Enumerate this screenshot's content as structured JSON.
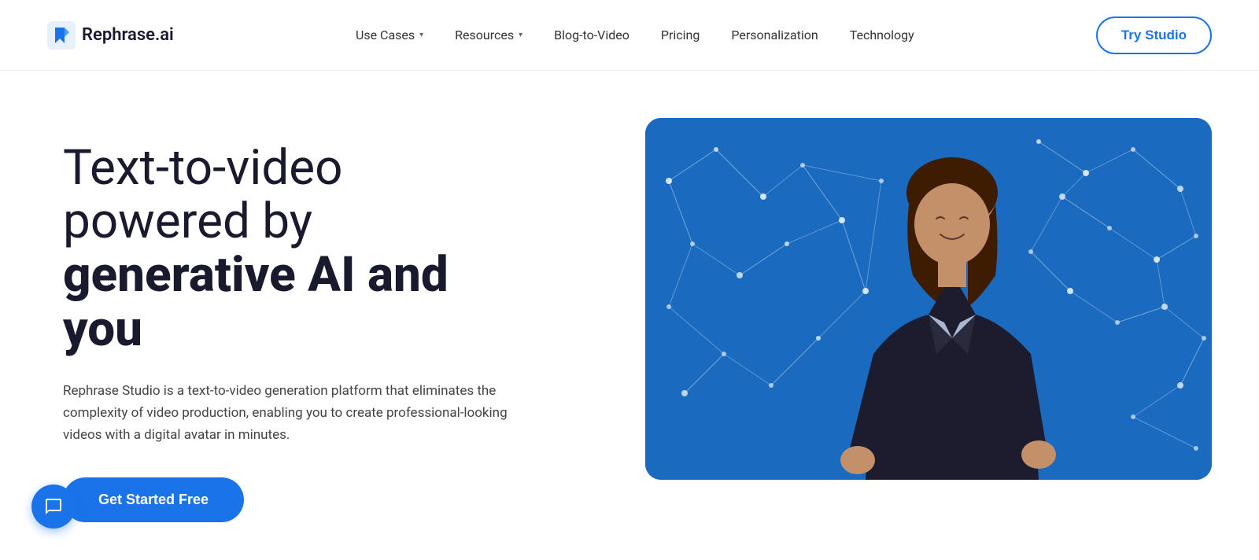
{
  "header": {
    "logo_text": "Rephrase.ai",
    "nav_items": [
      {
        "label": "Use Cases",
        "has_dropdown": true
      },
      {
        "label": "Resources",
        "has_dropdown": true
      },
      {
        "label": "Blog-to-Video",
        "has_dropdown": false
      },
      {
        "label": "Pricing",
        "has_dropdown": false
      },
      {
        "label": "Personalization",
        "has_dropdown": false
      },
      {
        "label": "Technology",
        "has_dropdown": false
      }
    ],
    "cta_label": "Try Studio"
  },
  "hero": {
    "headline_line1": "Text-to-video",
    "headline_line2": "powered by",
    "headline_line3": "generative AI and",
    "headline_line4": "you",
    "description": "Rephrase Studio is a text-to-video generation platform that eliminates the complexity of video production, enabling you to create professional-looking videos with a digital avatar in minutes.",
    "cta_label": "Get Started Free"
  },
  "chat": {
    "icon": "chat-icon"
  },
  "colors": {
    "brand_blue": "#1a73e8",
    "video_bg": "#1a6bbf",
    "text_dark": "#1a1a2e",
    "text_mid": "#444444"
  }
}
